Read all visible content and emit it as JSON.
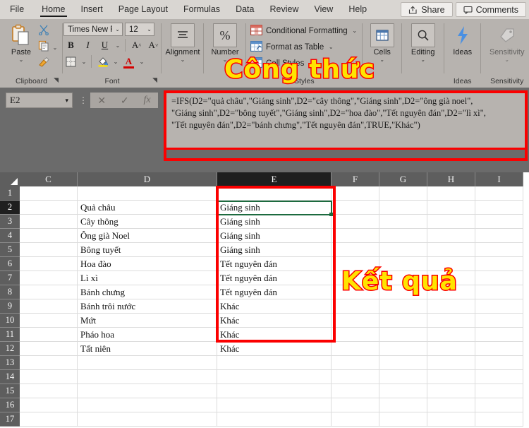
{
  "tabs": [
    {
      "label": "File",
      "active": false
    },
    {
      "label": "Home",
      "active": true
    },
    {
      "label": "Insert",
      "active": false
    },
    {
      "label": "Page Layout",
      "active": false
    },
    {
      "label": "Formulas",
      "active": false
    },
    {
      "label": "Data",
      "active": false
    },
    {
      "label": "Review",
      "active": false
    },
    {
      "label": "View",
      "active": false
    },
    {
      "label": "Help",
      "active": false
    }
  ],
  "topbuttons": [
    {
      "label": "Share",
      "icon": "share-icon"
    },
    {
      "label": "Comments",
      "icon": "comment-icon"
    }
  ],
  "ribbon": {
    "clipboard": {
      "group_label": "Clipboard",
      "paste_label": "Paste",
      "items": [
        "Cut",
        "Copy",
        "Format Painter"
      ]
    },
    "font": {
      "group_label": "Font",
      "font_name": "Times New Rc",
      "font_size": "12",
      "bold": "B",
      "italic": "I",
      "underline": "U",
      "grow_font": "A",
      "shrink_font": "A"
    },
    "alignment": {
      "group_label": "Alignment",
      "caption": "Alignment"
    },
    "number": {
      "group_label": "Number",
      "caption": "Number",
      "symbol": "%"
    },
    "styles": {
      "group_label": "Styles",
      "conditional_formatting": "Conditional Formatting",
      "format_as_table": "Format as Table",
      "cell_styles": "Cell Styles"
    },
    "cells": {
      "group_label": "Cells",
      "caption": "Cells"
    },
    "editing": {
      "group_label": "Editing",
      "caption": "Editing"
    },
    "ideas": {
      "group_label": "Ideas",
      "caption": "Ideas"
    },
    "sensitivity": {
      "group_label": "Sensitivity",
      "caption": "Sensitivity"
    }
  },
  "formula_bar": {
    "name_box": "E2",
    "cancel_icon": "close-icon",
    "confirm_icon": "check-icon",
    "function_icon": "fx-icon",
    "formula_lines": [
      "=IFS(D2=\"quả châu\",\"Giáng sinh\",D2=\"cây thông\",\"Giáng sinh\",D2=\"ông già noel\",",
      "\"Giáng sinh\",D2=\"bông tuyết\",\"Giáng sinh\",D2=\"hoa đào\",\"Tết nguyên đán\",D2=\"lì xì\",",
      "\"Tết nguyên đán\",D2=\"bánh chưng\",\"Tết nguyên đán\",TRUE,\"Khác\")"
    ]
  },
  "sheet": {
    "columns": [
      "C",
      "D",
      "E",
      "F",
      "G",
      "H",
      "I"
    ],
    "selected_column": "E",
    "selected_row": "2",
    "rows": [
      {
        "n": "1",
        "C": "",
        "D": "",
        "E": "",
        "F": "",
        "G": "",
        "H": "",
        "I": ""
      },
      {
        "n": "2",
        "C": "",
        "D": "Quả châu",
        "E": "Giáng sinh",
        "F": "",
        "G": "",
        "H": "",
        "I": ""
      },
      {
        "n": "3",
        "C": "",
        "D": "Cây thông",
        "E": "Giáng sinh",
        "F": "",
        "G": "",
        "H": "",
        "I": ""
      },
      {
        "n": "4",
        "C": "",
        "D": "Ông già Noel",
        "E": "Giáng sinh",
        "F": "",
        "G": "",
        "H": "",
        "I": ""
      },
      {
        "n": "5",
        "C": "",
        "D": "Bông tuyết",
        "E": "Giáng sinh",
        "F": "",
        "G": "",
        "H": "",
        "I": ""
      },
      {
        "n": "6",
        "C": "",
        "D": "Hoa đào",
        "E": "Tết nguyên đán",
        "F": "",
        "G": "",
        "H": "",
        "I": ""
      },
      {
        "n": "7",
        "C": "",
        "D": "Lì xì",
        "E": "Tết nguyên đán",
        "F": "",
        "G": "",
        "H": "",
        "I": ""
      },
      {
        "n": "8",
        "C": "",
        "D": "Bánh chưng",
        "E": "Tết nguyên đán",
        "F": "",
        "G": "",
        "H": "",
        "I": ""
      },
      {
        "n": "9",
        "C": "",
        "D": "Bánh trôi nước",
        "E": "Khác",
        "F": "",
        "G": "",
        "H": "",
        "I": ""
      },
      {
        "n": "10",
        "C": "",
        "D": "Mứt",
        "E": "Khác",
        "F": "",
        "G": "",
        "H": "",
        "I": ""
      },
      {
        "n": "11",
        "C": "",
        "D": "Pháo hoa",
        "E": "Khác",
        "F": "",
        "G": "",
        "H": "",
        "I": ""
      },
      {
        "n": "12",
        "C": "",
        "D": "Tất niên",
        "E": "Khác",
        "F": "",
        "G": "",
        "H": "",
        "I": ""
      },
      {
        "n": "13",
        "C": "",
        "D": "",
        "E": "",
        "F": "",
        "G": "",
        "H": "",
        "I": ""
      },
      {
        "n": "14",
        "C": "",
        "D": "",
        "E": "",
        "F": "",
        "G": "",
        "H": "",
        "I": ""
      },
      {
        "n": "15",
        "C": "",
        "D": "",
        "E": "",
        "F": "",
        "G": "",
        "H": "",
        "I": ""
      },
      {
        "n": "16",
        "C": "",
        "D": "",
        "E": "",
        "F": "",
        "G": "",
        "H": "",
        "I": ""
      },
      {
        "n": "17",
        "C": "",
        "D": "",
        "E": "",
        "F": "",
        "G": "",
        "H": "",
        "I": ""
      }
    ]
  },
  "annotations": {
    "formula_label": "Công thức",
    "result_label": "Kết quả",
    "highlight_color": "#fb0000",
    "wordart_fill": "#ffe400"
  }
}
